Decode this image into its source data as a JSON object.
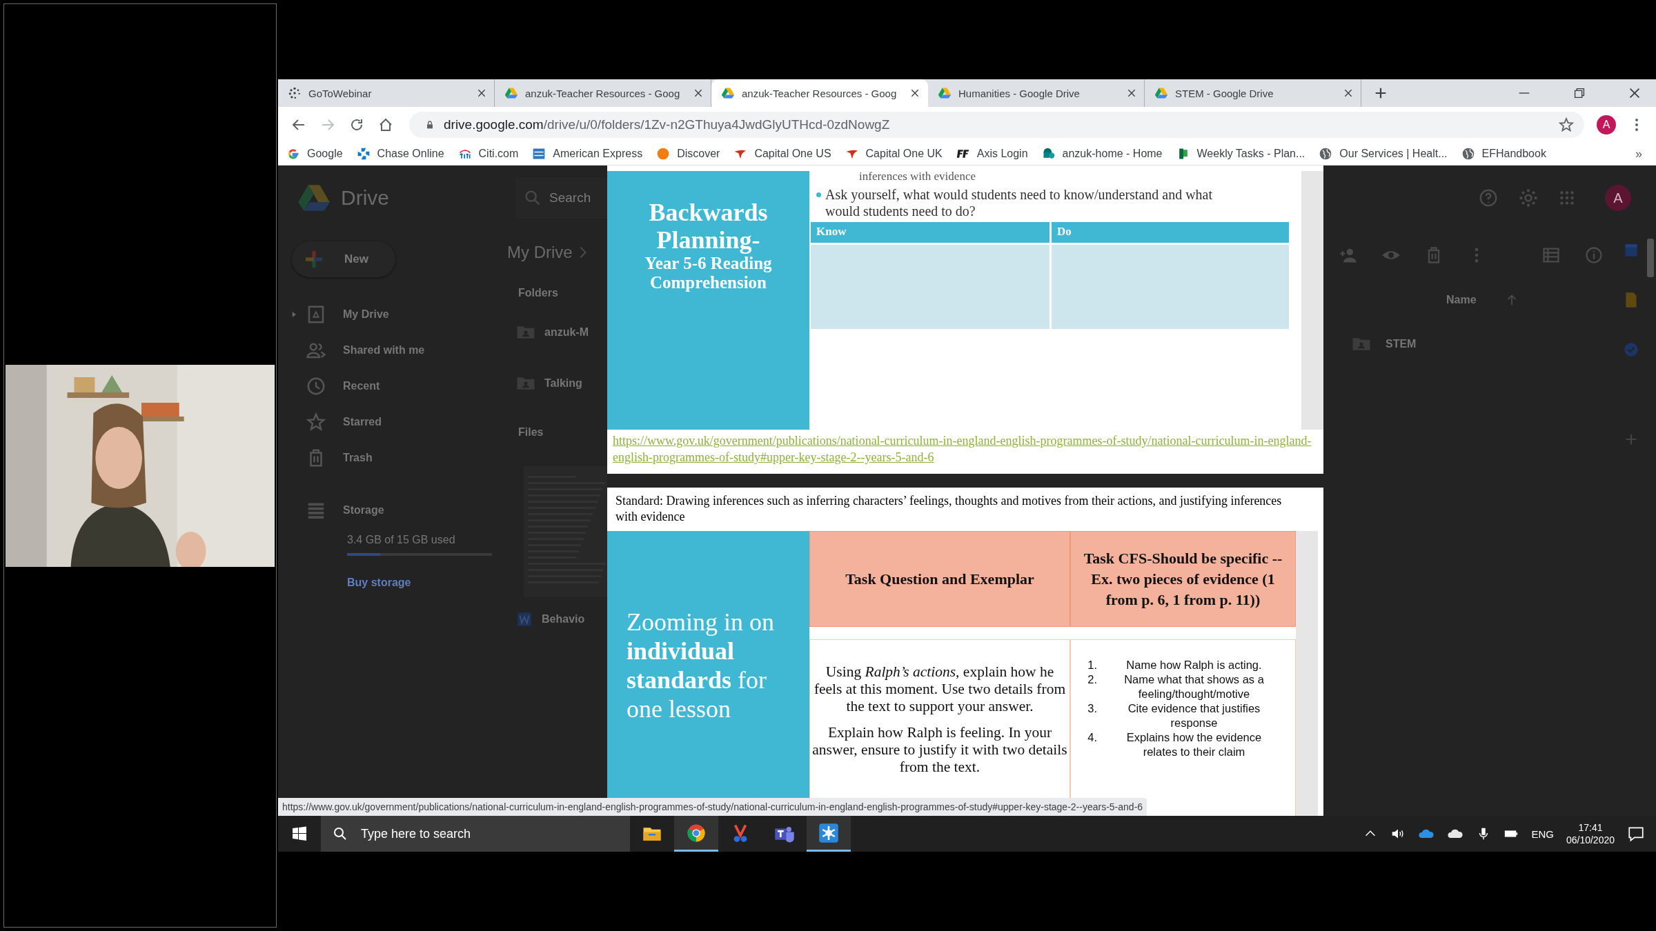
{
  "tabs": [
    {
      "title": "GoToWebinar",
      "selected": false
    },
    {
      "title": "anzuk-Teacher Resources - Goog",
      "selected": false
    },
    {
      "title": "anzuk-Teacher Resources - Goog",
      "selected": true
    },
    {
      "title": "Humanities - Google Drive",
      "selected": false
    },
    {
      "title": "STEM - Google Drive",
      "selected": false
    }
  ],
  "address_bar": {
    "host": "drive.google.com",
    "path": "/drive/u/0/folders/1Zv-n2GThuya4JwdGlyUTHcd-0zdNowgZ"
  },
  "profile_initial": "A",
  "bookmarks": [
    "Google",
    "Chase Online",
    "Citi.com",
    "American Express",
    "Discover",
    "Capital One US",
    "Capital One UK",
    "Axis Login",
    "anzuk-home - Home",
    "Weekly Tasks - Plan...",
    "Our Services | Healt...",
    "EFHandbook"
  ],
  "bookmarks_more": "»",
  "drive": {
    "product": "Drive",
    "search_placeholder": "Search",
    "new_button": "New",
    "nav": [
      {
        "label": "My Drive",
        "expandable": true
      },
      {
        "label": "Shared with me",
        "expandable": false
      },
      {
        "label": "Recent",
        "expandable": false
      },
      {
        "label": "Starred",
        "expandable": false
      },
      {
        "label": "Trash",
        "expandable": false
      }
    ],
    "storage": {
      "label": "Storage",
      "usage": "3.4 GB of 15 GB used",
      "level": 0.23,
      "buy": "Buy storage"
    },
    "breadcrumb": "My Drive",
    "folders_heading": "Folders",
    "folders": [
      "anzuk-M",
      "Talking"
    ],
    "files_heading": "Files",
    "files": [
      "Behavio"
    ],
    "sort_column": "Name",
    "right_folders": [
      "STEM"
    ],
    "avatar": "A"
  },
  "preview": {
    "page1": {
      "cut_line": "inferences with evidence",
      "panel_title": "Backwards Planning-",
      "panel_subtitle": "Year 5-6 Reading Comprehension",
      "bullet": "Ask yourself, what would students need to know/understand and what would students need to do?",
      "table_columns": [
        "Know",
        "Do"
      ],
      "link": "https://www.gov.uk/government/publications/national-curriculum-in-england-english-programmes-of-study/national-curriculum-in-england-english-programmes-of-study#upper-key-stage-2--years-5-and-6"
    },
    "page2": {
      "standard": "Standard: Drawing inferences such as inferring characters’ feelings, thoughts and motives from their actions, and justifying inferences with evidence",
      "panel_text": "Zooming in on **individual standards** for one lesson",
      "table_columns": [
        "Task Question and Exemplar",
        "Task CFS-Should be specific --Ex. two pieces of evidence (1 from p. 6, 1 from p. 11))"
      ],
      "task_paragraphs": [
        "Using *Ralph’s actions*, explain how he feels at this moment. Use two details from the text to support your answer.",
        "Explain how Ralph is feeling.  In your answer, ensure to justify it with two details from the text."
      ],
      "criteria": [
        {
          "number": "1.",
          "text": "Name how Ralph is acting."
        },
        {
          "number": "2.",
          "text": "Name what that shows as a feeling/thought/motive"
        },
        {
          "number": "3.",
          "text": "Cite evidence that justifies response"
        },
        {
          "number": "4.",
          "text": "Explains how the evidence relates to their claim"
        }
      ]
    }
  },
  "status_url": "https://www.gov.uk/government/publications/national-curriculum-in-england-english-programmes-of-study/national-curriculum-in-england-english-programmes-of-study#upper-key-stage-2--years-5-and-6",
  "taskbar": {
    "search_placeholder": "Type here to search",
    "apps": [
      {
        "kind": "explorer",
        "active": false
      },
      {
        "kind": "chrome",
        "active": true
      },
      {
        "kind": "snip",
        "active": false
      },
      {
        "kind": "teams",
        "active": false
      },
      {
        "kind": "snowflake",
        "active": true
      }
    ],
    "language": "ENG",
    "time": "17:41",
    "date": "06/10/2020"
  }
}
